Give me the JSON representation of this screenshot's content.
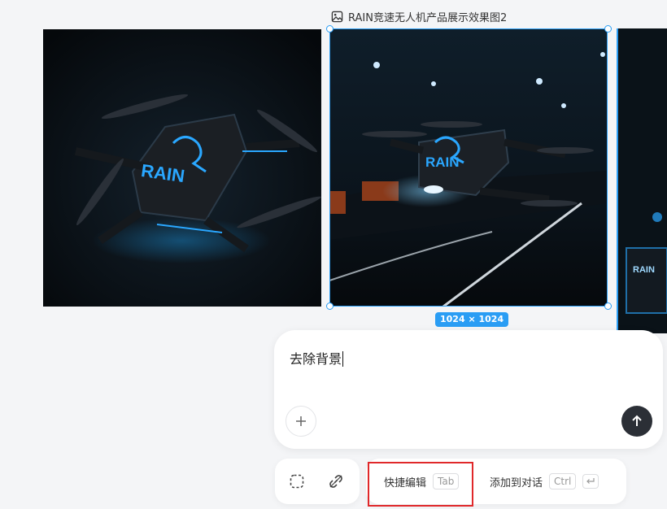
{
  "canvas": {
    "image_title": "RAIN竞速无人机产品展示效果图2",
    "image_title_icon": "image-icon",
    "size_badge": "1024 × 1024"
  },
  "images": [
    {
      "brand": "RAIN",
      "kind": "drone-dark-studio"
    },
    {
      "brand": "RAIN",
      "kind": "drone-racetrack",
      "selected": true
    },
    {
      "brand": "RAIN",
      "kind": "drone-box-partial"
    }
  ],
  "prompt": {
    "value": "去除背景",
    "add_icon": "plus-icon",
    "send_icon": "arrow-up-icon"
  },
  "toolbar": {
    "select_icon": "dashed-select-icon",
    "link_icon": "link-icon",
    "quick_edit_label": "快捷编辑",
    "quick_edit_key": "Tab",
    "add_to_chat_label": "添加到对话",
    "add_to_chat_key": "Ctrl",
    "enter_icon": "enter-key-icon"
  },
  "colors": {
    "selection": "#2a9df4",
    "highlight": "#e0282a",
    "send_button": "#2b2f36"
  }
}
